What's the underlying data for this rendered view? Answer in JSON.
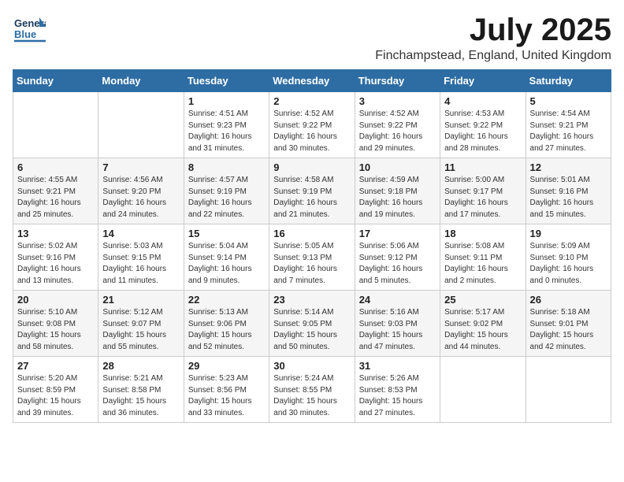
{
  "header": {
    "logo_general": "General",
    "logo_blue": "Blue",
    "month_year": "July 2025",
    "location": "Finchampstead, England, United Kingdom"
  },
  "weekdays": [
    "Sunday",
    "Monday",
    "Tuesday",
    "Wednesday",
    "Thursday",
    "Friday",
    "Saturday"
  ],
  "weeks": [
    [
      {
        "day": "",
        "info": ""
      },
      {
        "day": "",
        "info": ""
      },
      {
        "day": "1",
        "info": "Sunrise: 4:51 AM\nSunset: 9:23 PM\nDaylight: 16 hours\nand 31 minutes."
      },
      {
        "day": "2",
        "info": "Sunrise: 4:52 AM\nSunset: 9:22 PM\nDaylight: 16 hours\nand 30 minutes."
      },
      {
        "day": "3",
        "info": "Sunrise: 4:52 AM\nSunset: 9:22 PM\nDaylight: 16 hours\nand 29 minutes."
      },
      {
        "day": "4",
        "info": "Sunrise: 4:53 AM\nSunset: 9:22 PM\nDaylight: 16 hours\nand 28 minutes."
      },
      {
        "day": "5",
        "info": "Sunrise: 4:54 AM\nSunset: 9:21 PM\nDaylight: 16 hours\nand 27 minutes."
      }
    ],
    [
      {
        "day": "6",
        "info": "Sunrise: 4:55 AM\nSunset: 9:21 PM\nDaylight: 16 hours\nand 25 minutes."
      },
      {
        "day": "7",
        "info": "Sunrise: 4:56 AM\nSunset: 9:20 PM\nDaylight: 16 hours\nand 24 minutes."
      },
      {
        "day": "8",
        "info": "Sunrise: 4:57 AM\nSunset: 9:19 PM\nDaylight: 16 hours\nand 22 minutes."
      },
      {
        "day": "9",
        "info": "Sunrise: 4:58 AM\nSunset: 9:19 PM\nDaylight: 16 hours\nand 21 minutes."
      },
      {
        "day": "10",
        "info": "Sunrise: 4:59 AM\nSunset: 9:18 PM\nDaylight: 16 hours\nand 19 minutes."
      },
      {
        "day": "11",
        "info": "Sunrise: 5:00 AM\nSunset: 9:17 PM\nDaylight: 16 hours\nand 17 minutes."
      },
      {
        "day": "12",
        "info": "Sunrise: 5:01 AM\nSunset: 9:16 PM\nDaylight: 16 hours\nand 15 minutes."
      }
    ],
    [
      {
        "day": "13",
        "info": "Sunrise: 5:02 AM\nSunset: 9:16 PM\nDaylight: 16 hours\nand 13 minutes."
      },
      {
        "day": "14",
        "info": "Sunrise: 5:03 AM\nSunset: 9:15 PM\nDaylight: 16 hours\nand 11 minutes."
      },
      {
        "day": "15",
        "info": "Sunrise: 5:04 AM\nSunset: 9:14 PM\nDaylight: 16 hours\nand 9 minutes."
      },
      {
        "day": "16",
        "info": "Sunrise: 5:05 AM\nSunset: 9:13 PM\nDaylight: 16 hours\nand 7 minutes."
      },
      {
        "day": "17",
        "info": "Sunrise: 5:06 AM\nSunset: 9:12 PM\nDaylight: 16 hours\nand 5 minutes."
      },
      {
        "day": "18",
        "info": "Sunrise: 5:08 AM\nSunset: 9:11 PM\nDaylight: 16 hours\nand 2 minutes."
      },
      {
        "day": "19",
        "info": "Sunrise: 5:09 AM\nSunset: 9:10 PM\nDaylight: 16 hours\nand 0 minutes."
      }
    ],
    [
      {
        "day": "20",
        "info": "Sunrise: 5:10 AM\nSunset: 9:08 PM\nDaylight: 15 hours\nand 58 minutes."
      },
      {
        "day": "21",
        "info": "Sunrise: 5:12 AM\nSunset: 9:07 PM\nDaylight: 15 hours\nand 55 minutes."
      },
      {
        "day": "22",
        "info": "Sunrise: 5:13 AM\nSunset: 9:06 PM\nDaylight: 15 hours\nand 52 minutes."
      },
      {
        "day": "23",
        "info": "Sunrise: 5:14 AM\nSunset: 9:05 PM\nDaylight: 15 hours\nand 50 minutes."
      },
      {
        "day": "24",
        "info": "Sunrise: 5:16 AM\nSunset: 9:03 PM\nDaylight: 15 hours\nand 47 minutes."
      },
      {
        "day": "25",
        "info": "Sunrise: 5:17 AM\nSunset: 9:02 PM\nDaylight: 15 hours\nand 44 minutes."
      },
      {
        "day": "26",
        "info": "Sunrise: 5:18 AM\nSunset: 9:01 PM\nDaylight: 15 hours\nand 42 minutes."
      }
    ],
    [
      {
        "day": "27",
        "info": "Sunrise: 5:20 AM\nSunset: 8:59 PM\nDaylight: 15 hours\nand 39 minutes."
      },
      {
        "day": "28",
        "info": "Sunrise: 5:21 AM\nSunset: 8:58 PM\nDaylight: 15 hours\nand 36 minutes."
      },
      {
        "day": "29",
        "info": "Sunrise: 5:23 AM\nSunset: 8:56 PM\nDaylight: 15 hours\nand 33 minutes."
      },
      {
        "day": "30",
        "info": "Sunrise: 5:24 AM\nSunset: 8:55 PM\nDaylight: 15 hours\nand 30 minutes."
      },
      {
        "day": "31",
        "info": "Sunrise: 5:26 AM\nSunset: 8:53 PM\nDaylight: 15 hours\nand 27 minutes."
      },
      {
        "day": "",
        "info": ""
      },
      {
        "day": "",
        "info": ""
      }
    ]
  ]
}
